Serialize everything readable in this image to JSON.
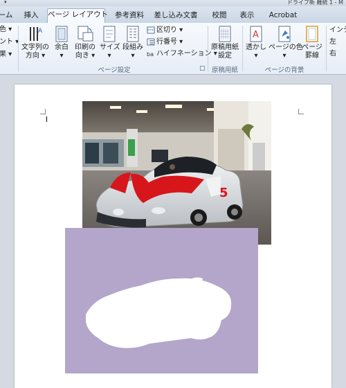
{
  "title_bar": {
    "qat_arrow": "▾",
    "document_title": "ドライブ新 難統 1 - M"
  },
  "tabs": [
    {
      "label": "ーム"
    },
    {
      "label": "挿入"
    },
    {
      "label": "ページ レイアウト",
      "active": true
    },
    {
      "label": "参考資料"
    },
    {
      "label": "差し込み文書"
    },
    {
      "label": "校閲"
    },
    {
      "label": "表示"
    },
    {
      "label": "Acrobat"
    }
  ],
  "ribbon": {
    "left_cut": [
      "色 ▾",
      "ント ▾",
      "果 ▾"
    ],
    "page_setup": {
      "label": "ページ設定",
      "text_direction": [
        "文字列の",
        "方向 ▾"
      ],
      "margins": [
        "余白",
        "▾"
      ],
      "orientation": [
        "印刷の",
        "向き ▾"
      ],
      "size": [
        "サイズ",
        "▾"
      ],
      "columns": [
        "段組み",
        "▾"
      ],
      "breaks": "区切り ▾",
      "line_numbers": "行番号 ▾",
      "hyphenation": "ハイフネーション ▾"
    },
    "manuscript": {
      "label": "原稿用紙",
      "button": [
        "原稿用紙",
        "設定"
      ]
    },
    "page_background": {
      "label": "ページの背景",
      "watermark": [
        "透かし",
        "▾"
      ],
      "page_color": [
        "ページの色",
        "▾"
      ],
      "page_borders": [
        "ページ",
        "罫線"
      ]
    },
    "right_cut": [
      "インデ",
      "左",
      "右"
    ]
  },
  "document": {
    "photo": {
      "description": "white roadster with red stripe in showroom"
    },
    "shape": {
      "fill": "#b3a6ca"
    }
  },
  "colors": {
    "accent_red": "#d7161c",
    "lilac": "#b3a6ca"
  }
}
